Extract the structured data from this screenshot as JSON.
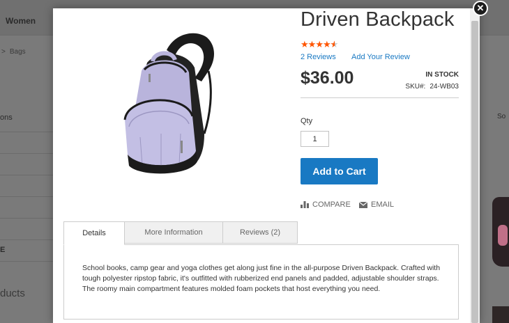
{
  "background": {
    "nav": {
      "item_women": "Women",
      "item_cut": ""
    },
    "breadcrumb": {
      "separator": ">",
      "current": "Bags"
    },
    "sidebar": {
      "title_fragment": "ons",
      "item_fragment": "E"
    },
    "products_fragment": "ducts",
    "right_fragment": "So"
  },
  "modal": {
    "close_icon": "close-icon",
    "product": {
      "name": "Driven Backpack",
      "rating": {
        "stars_filled": 4.5,
        "stars_total": 5,
        "color": "#ff5501"
      },
      "reviews_link": "2 Reviews",
      "add_review_link": "Add Your Review",
      "price": "$36.00",
      "stock_status": "IN STOCK",
      "sku_label": "SKU#:",
      "sku_value": "24-WB03",
      "image_icon": "backpack-image"
    },
    "cart": {
      "qty_label": "Qty",
      "qty_value": "1",
      "add_to_cart_label": "Add to Cart",
      "button_color": "#1979c3"
    },
    "actions": {
      "compare_label": "Compare",
      "compare_icon": "bar-chart-icon",
      "email_label": "Email",
      "email_icon": "envelope-icon"
    },
    "tabs": [
      {
        "label": "Details",
        "active": true
      },
      {
        "label": "More Information",
        "active": false
      },
      {
        "label": "Reviews (2)",
        "active": false
      }
    ],
    "description": "School books, camp gear and yoga clothes get along just fine in the all-purpose Driven Backpack. Crafted with tough polyester ripstop fabric, it's outfitted with rubberized end panels and padded, adjustable shoulder straps. The roomy main compartment features molded foam pockets that host everything you need."
  }
}
